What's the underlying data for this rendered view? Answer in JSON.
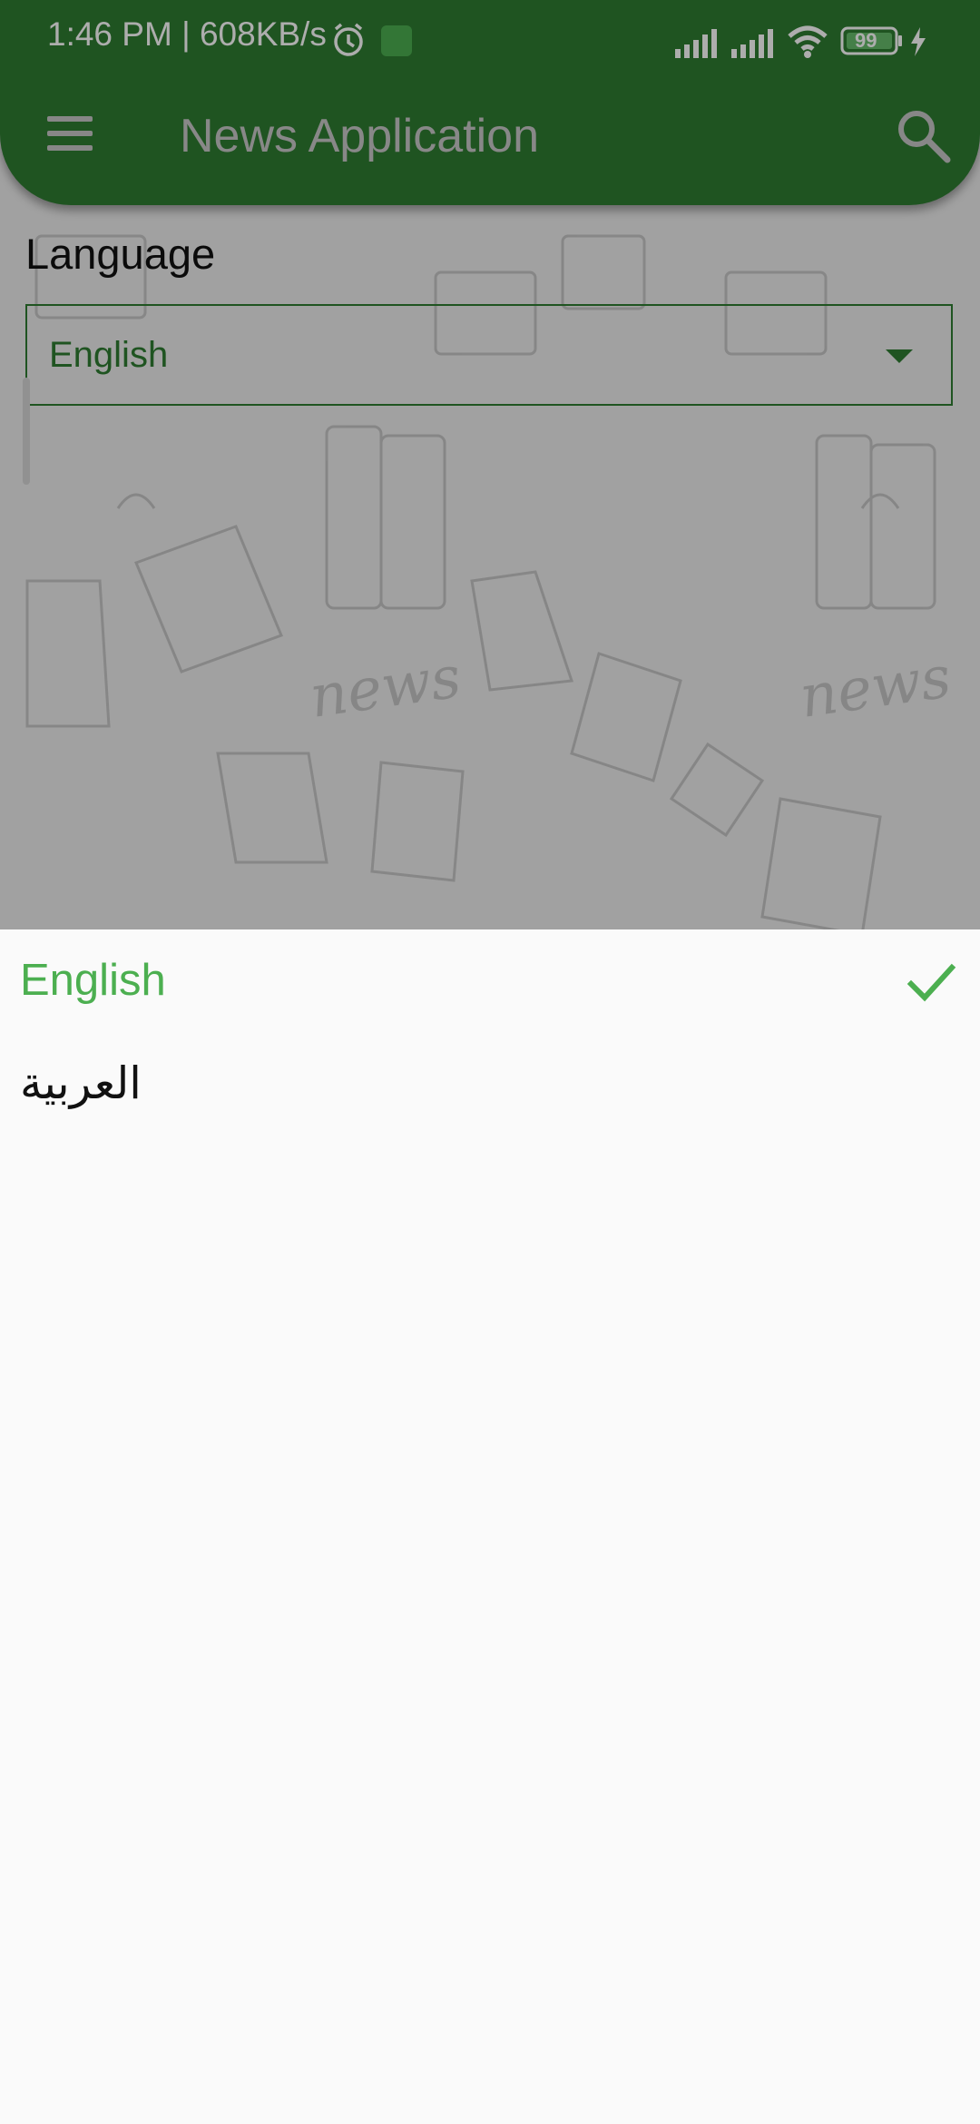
{
  "status_bar": {
    "time": "1:46 PM | 608KB/s",
    "battery": "99"
  },
  "app_bar": {
    "title": "News Application",
    "menu_icon": "hamburger-menu-icon",
    "search_icon": "search-icon"
  },
  "settings": {
    "language_label": "Language",
    "language_value": "English"
  },
  "language_options": [
    {
      "label": "English",
      "selected": true
    },
    {
      "label": "العربية",
      "selected": false
    }
  ],
  "colors": {
    "primary": "#2e7d32",
    "accent": "#4caf50",
    "scrim": "rgba(0,0,0,0.32)"
  }
}
